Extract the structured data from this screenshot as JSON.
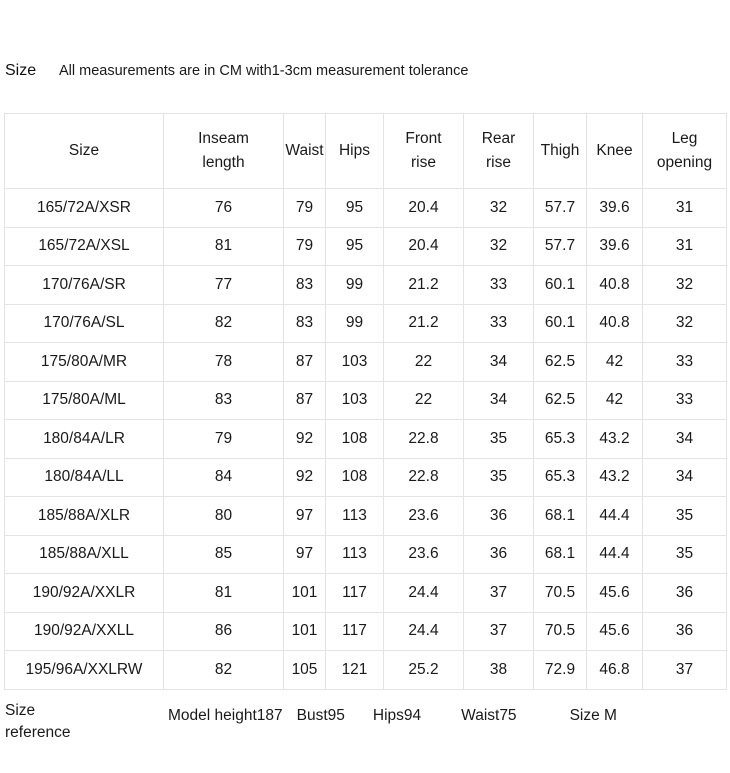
{
  "header": {
    "label": "Size",
    "note": "All measurements are in CM with1-3cm measurement tolerance"
  },
  "table": {
    "columns": [
      {
        "key": "size",
        "label": "Size",
        "line1": "Size",
        "line2": ""
      },
      {
        "key": "inseam",
        "label": "Inseam length",
        "line1": "Inseam",
        "line2": "length"
      },
      {
        "key": "waist",
        "label": "Waist",
        "line1": "Waist",
        "line2": ""
      },
      {
        "key": "hips",
        "label": "Hips",
        "line1": "Hips",
        "line2": ""
      },
      {
        "key": "front_rise",
        "label": "Front rise",
        "line1": "Front",
        "line2": "rise"
      },
      {
        "key": "rear_rise",
        "label": "Rear rise",
        "line1": "Rear",
        "line2": "rise"
      },
      {
        "key": "thigh",
        "label": "Thigh",
        "line1": "Thigh",
        "line2": ""
      },
      {
        "key": "knee",
        "label": "Knee",
        "line1": "Knee",
        "line2": ""
      },
      {
        "key": "leg_opening",
        "label": "Leg opening",
        "line1": "Leg",
        "line2": "opening"
      }
    ],
    "rows": [
      {
        "size": "165/72A/XSR",
        "inseam": "76",
        "waist": "79",
        "hips": "95",
        "front_rise": "20.4",
        "rear_rise": "32",
        "thigh": "57.7",
        "knee": "39.6",
        "leg_opening": "31"
      },
      {
        "size": "165/72A/XSL",
        "inseam": "81",
        "waist": "79",
        "hips": "95",
        "front_rise": "20.4",
        "rear_rise": "32",
        "thigh": "57.7",
        "knee": "39.6",
        "leg_opening": "31"
      },
      {
        "size": "170/76A/SR",
        "inseam": "77",
        "waist": "83",
        "hips": "99",
        "front_rise": "21.2",
        "rear_rise": "33",
        "thigh": "60.1",
        "knee": "40.8",
        "leg_opening": "32"
      },
      {
        "size": "170/76A/SL",
        "inseam": "82",
        "waist": "83",
        "hips": "99",
        "front_rise": "21.2",
        "rear_rise": "33",
        "thigh": "60.1",
        "knee": "40.8",
        "leg_opening": "32"
      },
      {
        "size": "175/80A/MR",
        "inseam": "78",
        "waist": "87",
        "hips": "103",
        "front_rise": "22",
        "rear_rise": "34",
        "thigh": "62.5",
        "knee": "42",
        "leg_opening": "33"
      },
      {
        "size": "175/80A/ML",
        "inseam": "83",
        "waist": "87",
        "hips": "103",
        "front_rise": "22",
        "rear_rise": "34",
        "thigh": "62.5",
        "knee": "42",
        "leg_opening": "33"
      },
      {
        "size": "180/84A/LR",
        "inseam": "79",
        "waist": "92",
        "hips": "108",
        "front_rise": "22.8",
        "rear_rise": "35",
        "thigh": "65.3",
        "knee": "43.2",
        "leg_opening": "34"
      },
      {
        "size": "180/84A/LL",
        "inseam": "84",
        "waist": "92",
        "hips": "108",
        "front_rise": "22.8",
        "rear_rise": "35",
        "thigh": "65.3",
        "knee": "43.2",
        "leg_opening": "34"
      },
      {
        "size": "185/88A/XLR",
        "inseam": "80",
        "waist": "97",
        "hips": "113",
        "front_rise": "23.6",
        "rear_rise": "36",
        "thigh": "68.1",
        "knee": "44.4",
        "leg_opening": "35"
      },
      {
        "size": "185/88A/XLL",
        "inseam": "85",
        "waist": "97",
        "hips": "113",
        "front_rise": "23.6",
        "rear_rise": "36",
        "thigh": "68.1",
        "knee": "44.4",
        "leg_opening": "35"
      },
      {
        "size": "190/92A/XXLR",
        "inseam": "81",
        "waist": "101",
        "hips": "117",
        "front_rise": "24.4",
        "rear_rise": "37",
        "thigh": "70.5",
        "knee": "45.6",
        "leg_opening": "36"
      },
      {
        "size": "190/92A/XXLL",
        "inseam": "86",
        "waist": "101",
        "hips": "117",
        "front_rise": "24.4",
        "rear_rise": "37",
        "thigh": "70.5",
        "knee": "45.6",
        "leg_opening": "36"
      },
      {
        "size": "195/96A/XXLRW",
        "inseam": "82",
        "waist": "105",
        "hips": "121",
        "front_rise": "25.2",
        "rear_rise": "38",
        "thigh": "72.9",
        "knee": "46.8",
        "leg_opening": "37"
      }
    ]
  },
  "reference": {
    "label_line1": "Size",
    "label_line2": "reference",
    "items": [
      "Model height187",
      "Bust95",
      "Hips94",
      "Waist75",
      "Size M"
    ]
  },
  "colors": {
    "text": "#1a1a1a",
    "grid": "#e3e3e3",
    "background": "#ffffff"
  }
}
